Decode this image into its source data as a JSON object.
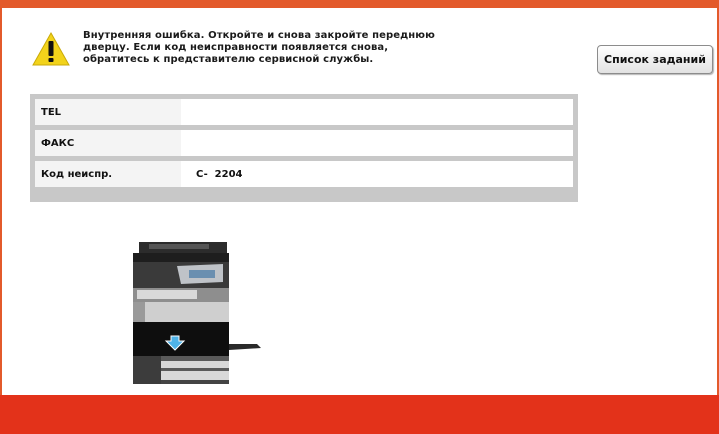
{
  "message": {
    "lines": [
      "Внутренняя ошибка. Откройте и снова закройте переднюю",
      "дверцу. Если код неисправности появляется снова,",
      "обратитесь к представителю сервисной службы."
    ]
  },
  "job_list_button": {
    "label": "Список заданий"
  },
  "info": {
    "rows": [
      {
        "label": "TEL",
        "value": ""
      },
      {
        "label": "ФАКС",
        "value": ""
      },
      {
        "label": "Код неиспр.",
        "value": "C-  2204"
      }
    ]
  },
  "colors": {
    "frame": "#e35a2b",
    "bottom_bar": "#e3321a",
    "warning": "#f2d31b",
    "arrow": "#4fb3e8"
  },
  "icons": {
    "warning": "warning-icon",
    "device": "printer-illustration",
    "arrow": "arrow-down-icon"
  }
}
